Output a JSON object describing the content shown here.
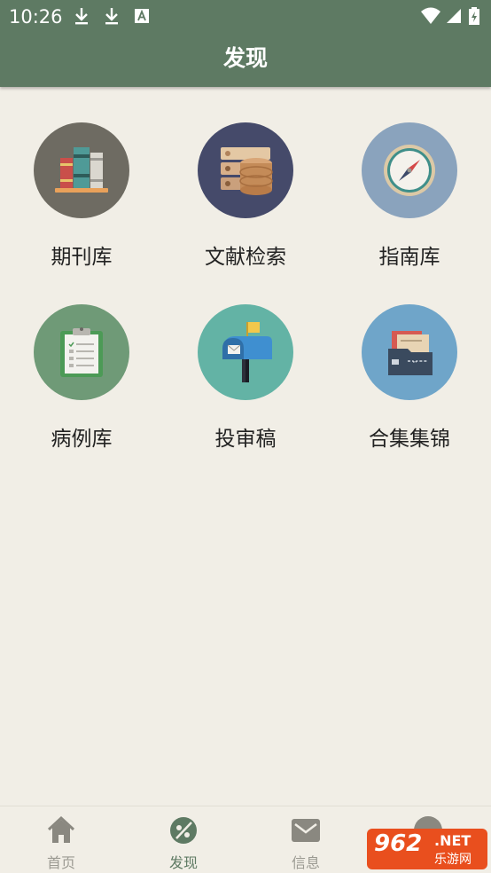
{
  "status": {
    "time": "10:26"
  },
  "header": {
    "title": "发现"
  },
  "tiles": [
    {
      "label": "期刊库",
      "icon": "books-icon",
      "color": "#6e6b62"
    },
    {
      "label": "文献检索",
      "icon": "database-icon",
      "color": "#454a6a"
    },
    {
      "label": "指南库",
      "icon": "compass-icon",
      "color": "#8aa3bd"
    },
    {
      "label": "病例库",
      "icon": "clipboard-icon",
      "color": "#6f9a77"
    },
    {
      "label": "投审稿",
      "icon": "mailbox-icon",
      "color": "#63b3a5"
    },
    {
      "label": "合集集锦",
      "icon": "folder-icon",
      "color": "#6fa5c9"
    }
  ],
  "bottom_nav": [
    {
      "label": "首页",
      "icon": "home-icon"
    },
    {
      "label": "发现",
      "icon": "discover-icon",
      "active": true
    },
    {
      "label": "信息",
      "icon": "mail-icon"
    },
    {
      "label": "",
      "icon": "profile-icon"
    }
  ],
  "watermark": {
    "brand": "962",
    "suffix": ".NET",
    "subtitle": "乐游网"
  },
  "colors": {
    "header": "#5e7a63",
    "background": "#f1eee6",
    "active_nav": "#5e7a63"
  }
}
